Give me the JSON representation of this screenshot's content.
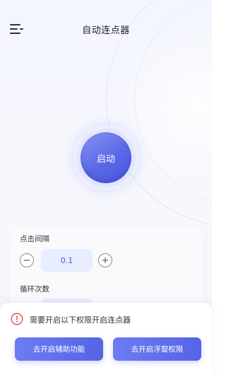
{
  "header": {
    "title": "自动连点器"
  },
  "start": {
    "label": "启动"
  },
  "settings": {
    "interval": {
      "label": "点击间隔",
      "value": "0.1"
    },
    "loop": {
      "label": "循环次数"
    }
  },
  "permission": {
    "message": "需要开启以下权限开启连点器",
    "accessibility_button": "去开启辅助功能",
    "overlay_button": "去开启浮窗权限"
  },
  "colors": {
    "accent": "#5b68e6",
    "warning": "#d94a4a"
  }
}
